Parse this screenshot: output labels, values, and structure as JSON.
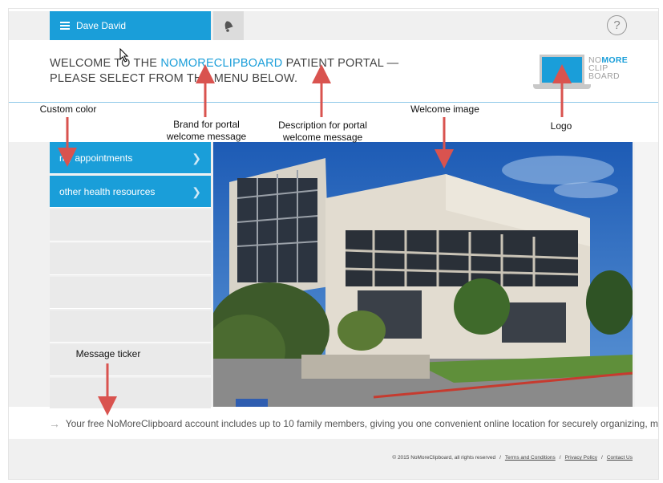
{
  "header": {
    "user_name": "Dave David",
    "help_label": "?"
  },
  "welcome": {
    "prefix": "WELCOME TO THE ",
    "brand": "NOMORECLIPBOARD",
    "suffix_line1": " PATIENT PORTAL —",
    "line2": "PLEASE SELECT FROM THE MENU BELOW."
  },
  "logo": {
    "no": "NO",
    "more": "MORE",
    "clip": "CLIP",
    "board": "BOARD"
  },
  "menu": {
    "items": [
      {
        "label": "my appointments"
      },
      {
        "label": "other health resources"
      }
    ]
  },
  "annotations": {
    "custom_color": "Custom color",
    "brand_line1": "Brand for portal",
    "brand_line2": "welcome message",
    "desc_line1": "Description for portal",
    "desc_line2": "welcome message",
    "welcome_image": "Welcome image",
    "logo": "Logo",
    "message_ticker": "Message ticker"
  },
  "ticker": {
    "message": "Your free NoMoreClipboard account includes up to 10 family members, giving you one convenient online location for securely organizing, m"
  },
  "footer": {
    "copyright": "© 2015 NoMoreClipboard, all rights reserved",
    "terms": "Terms and Conditions",
    "privacy": "Privacy Policy",
    "contact": "Contact Us"
  },
  "colors": {
    "accent": "#1a9ed9",
    "annotation_arrow": "#d9534f"
  }
}
